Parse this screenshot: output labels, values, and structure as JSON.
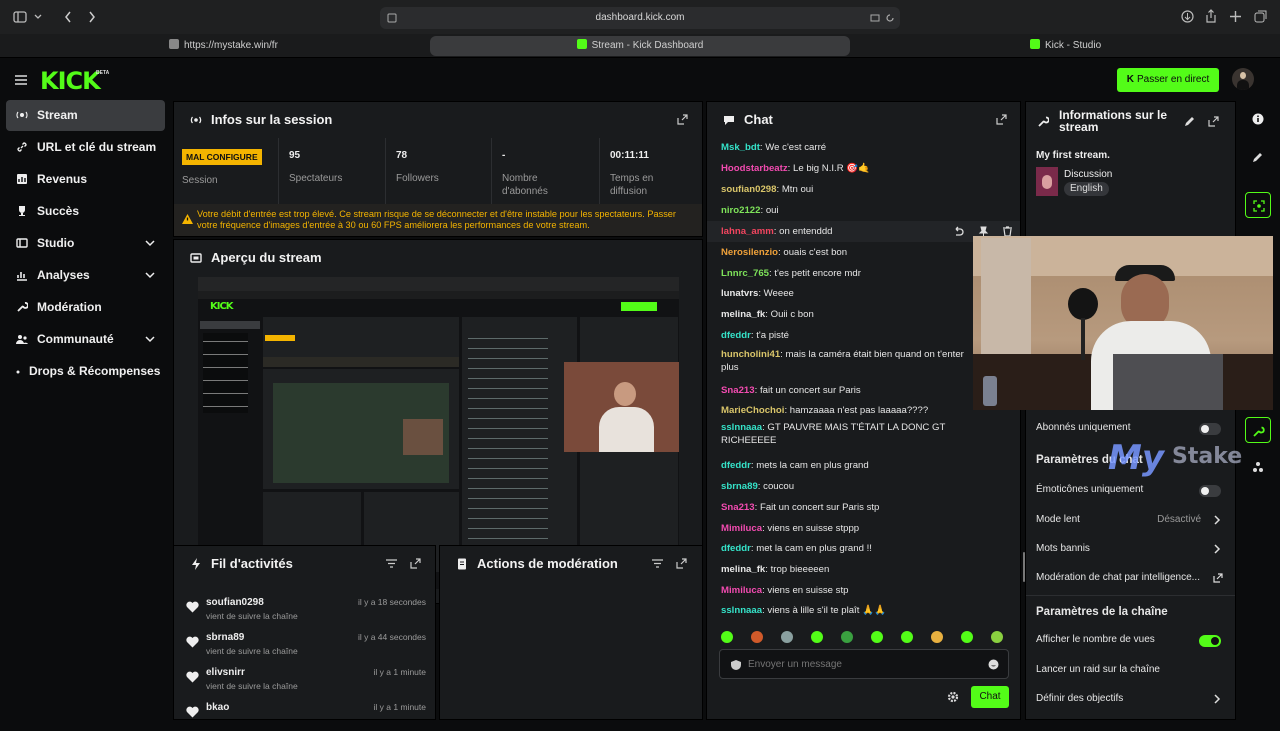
{
  "browser": {
    "url": "dashboard.kick.com",
    "tabs": [
      "https://mystake.win/fr",
      "Stream - Kick Dashboard",
      "Kick - Studio"
    ]
  },
  "header": {
    "logo": "KICK",
    "beta": "BETA",
    "go_live": "Passer en direct"
  },
  "sidebar": {
    "items": [
      {
        "label": "Stream",
        "icon": "stream-icon"
      },
      {
        "label": "URL et clé du stream",
        "icon": "link-icon"
      },
      {
        "label": "Revenus",
        "icon": "revenue-icon"
      },
      {
        "label": "Succès",
        "icon": "trophy-icon"
      },
      {
        "label": "Studio",
        "icon": "studio-icon"
      },
      {
        "label": "Analyses",
        "icon": "chart-icon"
      },
      {
        "label": "Modération",
        "icon": "wrench-icon"
      },
      {
        "label": "Communauté",
        "icon": "users-icon"
      },
      {
        "label": "Drops & Récompenses",
        "icon": "dot-icon"
      }
    ]
  },
  "session": {
    "title": "Infos sur la session",
    "badge": "MAL CONFIGURE",
    "badge_label": "Session",
    "stats": [
      {
        "value": "95",
        "label": "Spectateurs"
      },
      {
        "value": "78",
        "label": "Followers"
      },
      {
        "value": "-",
        "label": "Nombre d'abonnés"
      },
      {
        "value": "00:11:11",
        "label": "Temps en diffusion"
      }
    ],
    "warning": "Votre débit d'entrée est trop élevé. Ce stream risque de se déconnecter et d'être instable pour les spectateurs. Passer votre fréquence d'images d'entrée à 30 ou 60 FPS améliorera les performances de votre stream."
  },
  "preview": {
    "title": "Aperçu du stream"
  },
  "activity": {
    "title": "Fil d'activités",
    "items": [
      {
        "name": "soufian0298",
        "sub": "vient de suivre la chaîne",
        "time": "il y a 18 secondes"
      },
      {
        "name": "sbrna89",
        "sub": "vient de suivre la chaîne",
        "time": "il y a 44 secondes"
      },
      {
        "name": "elivsnirr",
        "sub": "vient de suivre la chaîne",
        "time": "il y a 1 minute"
      },
      {
        "name": "bkao",
        "sub": "",
        "time": "il y a 1 minute"
      }
    ]
  },
  "moderation": {
    "title": "Actions de modération"
  },
  "chat": {
    "title": "Chat",
    "messages": [
      {
        "user": "Msk_bdt",
        "color": "#35e3c9",
        "text": "We c'est carré"
      },
      {
        "user": "Hoodstarbeatz",
        "color": "#f24bb0",
        "text": "Le big N.I.R 🎯🤙"
      },
      {
        "user": "soufian0298",
        "color": "#d9c56a",
        "text": "Mtn oui"
      },
      {
        "user": "niro2122",
        "color": "#7ee35a",
        "text": "oui"
      },
      {
        "user": "lahna_amm",
        "color": "#f2455f",
        "text": "on entenddd"
      },
      {
        "user": "Nerosilenzio",
        "color": "#f0a23a",
        "text": "ouais c'est bon"
      },
      {
        "user": "Lnnrc_765",
        "color": "#7ee35a",
        "text": "t'es petit encore mdr"
      },
      {
        "user": "lunatvrs",
        "color": "#e8e8e8",
        "text": "Weeee"
      },
      {
        "user": "melina_fk",
        "color": "#e8e8e8",
        "text": "Ouii c bon"
      },
      {
        "user": "dfeddr",
        "color": "#35e3c9",
        "text": "t'a pisté"
      },
      {
        "user": "huncholini41",
        "color": "#d9c56a",
        "text": "mais la caméra était bien quand on t'enter plus"
      },
      {
        "user": "Sna213",
        "color": "#f24bb0",
        "text": "fait un concert sur Paris"
      },
      {
        "user": "MarieChochoi",
        "color": "#d9c56a",
        "text": "hamzaaaa n'est pas laaaaa????"
      },
      {
        "user": "sslnnaaa",
        "color": "#35e3c9",
        "text": "GT PAUVRE MAIS T'ÉTAIT LA DONC GT RICHEEEEE"
      },
      {
        "user": "dfeddr",
        "color": "#35e3c9",
        "text": "mets la cam en plus grand"
      },
      {
        "user": "sbrna89",
        "color": "#35e3c9",
        "text": "coucou"
      },
      {
        "user": "Sna213",
        "color": "#f24bb0",
        "text": "Fait un concert sur Paris stp"
      },
      {
        "user": "Mimiluca",
        "color": "#f24bb0",
        "text": "viens en suisse stppp"
      },
      {
        "user": "dfeddr",
        "color": "#35e3c9",
        "text": "met la cam en plus grand !!"
      },
      {
        "user": "melina_fk",
        "color": "#e8e8e8",
        "text": "trop bieeeeen"
      },
      {
        "user": "Mimiluca",
        "color": "#f24bb0",
        "text": "viens en suisse stp"
      },
      {
        "user": "sslnnaaa",
        "color": "#35e3c9",
        "text": "viens à lille s'il te plaît 🙏🙏"
      }
    ],
    "placeholder": "Envoyer un message",
    "send": "Chat"
  },
  "info": {
    "title": "Informations sur le stream",
    "stream_title": "My first stream.",
    "category": "Discussion",
    "language": "English",
    "subs_only": "Abonnés uniquement",
    "chat_settings_title": "Paramètres du chat",
    "emotes_only": "Émoticônes uniquement",
    "slow_mode": "Mode lent",
    "slow_mode_value": "Désactivé",
    "banned_words": "Mots bannis",
    "ai_moderation": "Modération de chat par intelligence...",
    "channel_settings_title": "Paramètres de la chaîne",
    "show_viewers": "Afficher le nombre de vues",
    "raid": "Lancer un raid sur la chaîne",
    "goals": "Définir des objectifs"
  },
  "overlay": {
    "watermark": "MyStake"
  }
}
